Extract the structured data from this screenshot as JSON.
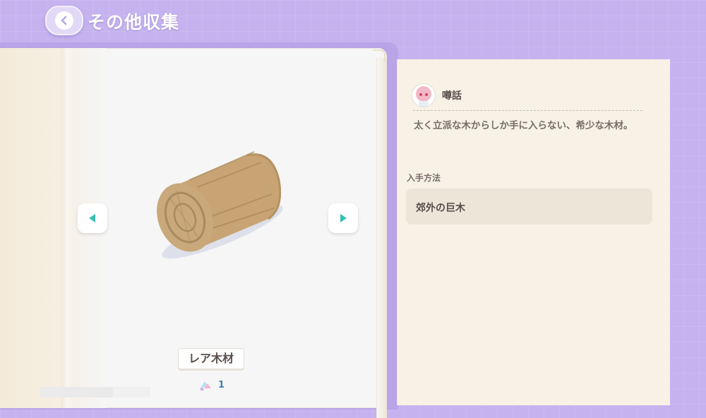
{
  "header": {
    "title": "その他収集",
    "back_icon": "back-arrow-icon"
  },
  "item": {
    "name": "レア木材",
    "count": "1",
    "image": "wood-log-icon",
    "count_icon": "collection-icon"
  },
  "navigation": {
    "prev_icon": "triangle-left-icon",
    "next_icon": "triangle-right-icon"
  },
  "info": {
    "rumor_label": "噂話",
    "rumor_text": "太く立派な木からしか手に入らない、希少な木材。",
    "acquisition_label": "入手方法",
    "acquisition_method": "郊外の巨木"
  },
  "colors": {
    "background": "#c4b3ef",
    "accent": "#36bfb4",
    "panel": "#f8f1e6"
  }
}
